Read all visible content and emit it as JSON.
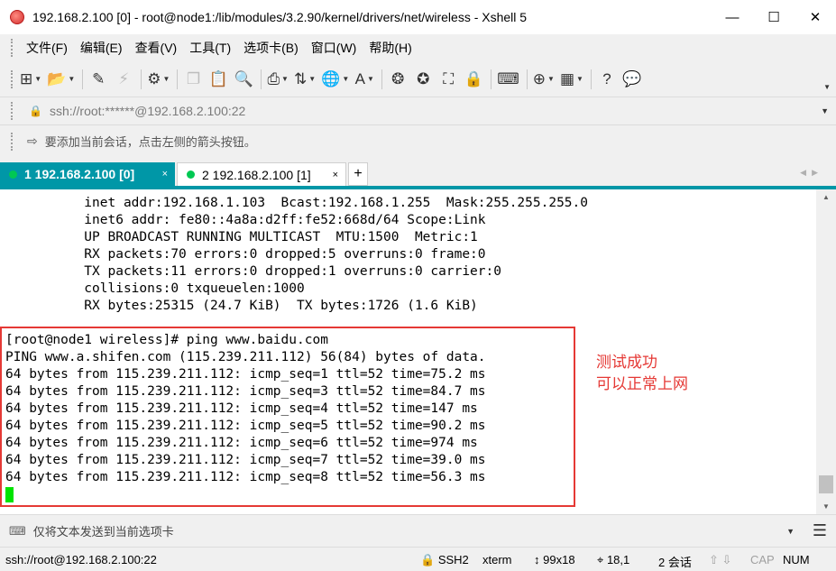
{
  "window": {
    "title": "192.168.2.100 [0] - root@node1:/lib/modules/3.2.90/kernel/drivers/net/wireless - Xshell 5",
    "minimize": "—",
    "maximize": "☐",
    "close": "✕"
  },
  "menu": {
    "items": [
      {
        "label": "文件(F)"
      },
      {
        "label": "编辑(E)"
      },
      {
        "label": "查看(V)"
      },
      {
        "label": "工具(T)"
      },
      {
        "label": "选项卡(B)"
      },
      {
        "label": "窗口(W)"
      },
      {
        "label": "帮助(H)"
      }
    ]
  },
  "toolbar": {
    "icons": [
      "new-session-icon",
      "open-folder-icon",
      "edit-icon",
      "disconnect-icon",
      "properties-icon",
      "copy-icon",
      "paste-icon",
      "find-icon",
      "print-icon",
      "transfer-icon",
      "globe-icon",
      "font-icon",
      "xftp-icon",
      "xmanager-icon",
      "fullscreen-icon",
      "lock-icon",
      "keyboard-icon",
      "add-tab-icon",
      "layout-icon",
      "help-icon",
      "chat-icon"
    ]
  },
  "address": {
    "value": "ssh://root:******@192.168.2.100:22"
  },
  "hint": {
    "text": "要添加当前会话，点击左侧的箭头按钮。"
  },
  "tabs": [
    {
      "label": "1 192.168.2.100 [0]",
      "active": true,
      "status_color": "#00c853",
      "close": "×"
    },
    {
      "label": "2 192.168.2.100 [1]",
      "active": false,
      "status_color": "#00c853",
      "close": "×"
    }
  ],
  "tab_add": "+",
  "terminal": {
    "lines": [
      "          inet addr:192.168.1.103  Bcast:192.168.1.255  Mask:255.255.255.0",
      "          inet6 addr: fe80::4a8a:d2ff:fe52:668d/64 Scope:Link",
      "          UP BROADCAST RUNNING MULTICAST  MTU:1500  Metric:1",
      "          RX packets:70 errors:0 dropped:5 overruns:0 frame:0",
      "          TX packets:11 errors:0 dropped:1 overruns:0 carrier:0",
      "          collisions:0 txqueuelen:1000",
      "          RX bytes:25315 (24.7 KiB)  TX bytes:1726 (1.6 KiB)",
      "",
      "[root@node1 wireless]# ping www.baidu.com",
      "PING www.a.shifen.com (115.239.211.112) 56(84) bytes of data.",
      "64 bytes from 115.239.211.112: icmp_seq=1 ttl=52 time=75.2 ms",
      "64 bytes from 115.239.211.112: icmp_seq=3 ttl=52 time=84.7 ms",
      "64 bytes from 115.239.211.112: icmp_seq=4 ttl=52 time=147 ms",
      "64 bytes from 115.239.211.112: icmp_seq=5 ttl=52 time=90.2 ms",
      "64 bytes from 115.239.211.112: icmp_seq=6 ttl=52 time=974 ms",
      "64 bytes from 115.239.211.112: icmp_seq=7 ttl=52 time=39.0 ms",
      "64 bytes from 115.239.211.112: icmp_seq=8 ttl=52 time=56.3 ms"
    ],
    "cursor_color": "#00e400",
    "annotation": [
      "测试成功",
      "可以正常上网"
    ],
    "annotation_color": "#e53935"
  },
  "sendbar": {
    "text": "仅将文本发送到当前选项卡"
  },
  "status": {
    "connection": "ssh://root@192.168.2.100:22",
    "protocol": "SSH2",
    "terminal_type": "xterm",
    "size": "99x18",
    "position": "18,1",
    "sessions": "2 会话",
    "caps": "CAP",
    "num": "NUM"
  },
  "colors": {
    "accent": "#0097a7",
    "highlight_border": "#e53935"
  }
}
